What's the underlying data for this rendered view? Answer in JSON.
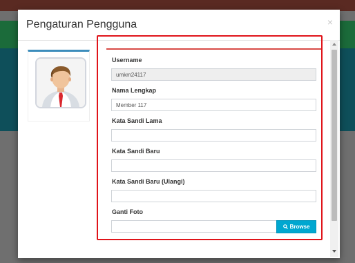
{
  "modal": {
    "title": "Pengaturan Pengguna",
    "close_glyph": "×"
  },
  "profile": {
    "avatar_icon": "user-avatar-icon"
  },
  "form": {
    "username": {
      "label": "Username",
      "value": "umkm24117"
    },
    "nama_lengkap": {
      "label": "Nama Lengkap",
      "value": "Member 117"
    },
    "kata_sandi_lama": {
      "label": "Kata Sandi Lama",
      "value": ""
    },
    "kata_sandi_baru": {
      "label": "Kata Sandi Baru",
      "value": ""
    },
    "kata_sandi_baru_ulangi": {
      "label": "Kata Sandi Baru (Ulangi)",
      "value": ""
    },
    "ganti_foto": {
      "label": "Ganti Foto",
      "value": "",
      "browse_label": "Browse",
      "browse_icon": "search-icon"
    }
  },
  "colors": {
    "highlight_border": "#e0141a",
    "panel_accent": "#d84a45",
    "card_accent": "#3c8dbc",
    "browse_button": "#00a7d0"
  }
}
